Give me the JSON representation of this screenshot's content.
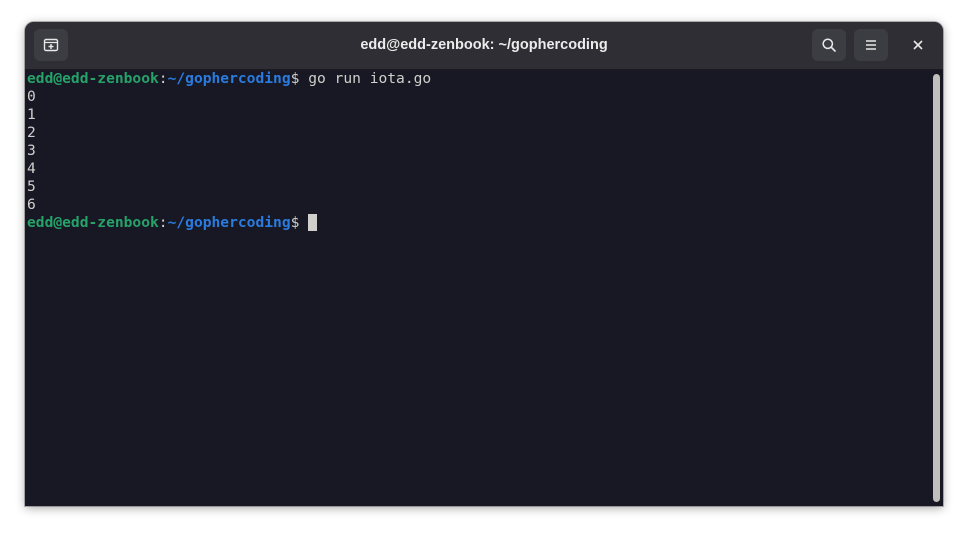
{
  "window": {
    "title": "edd@edd-zenbook: ~/gophercoding"
  },
  "header": {
    "new_tab_icon": "new-tab-icon",
    "search_icon": "search-icon",
    "menu_icon": "hamburger-menu-icon",
    "close_icon": "close-icon"
  },
  "terminal": {
    "prompt_user": "edd@edd-zenbook",
    "prompt_sep": ":",
    "prompt_path": "~/gophercoding",
    "prompt_symbol": "$ ",
    "command": "go run iota.go",
    "output": [
      "0",
      "1",
      "2",
      "3",
      "4",
      "5",
      "6"
    ]
  },
  "colors": {
    "background": "#181824",
    "header": "#2e2e34",
    "prompt_user": "#26a269",
    "prompt_path": "#2a7bde",
    "text": "#d0cfcc"
  }
}
